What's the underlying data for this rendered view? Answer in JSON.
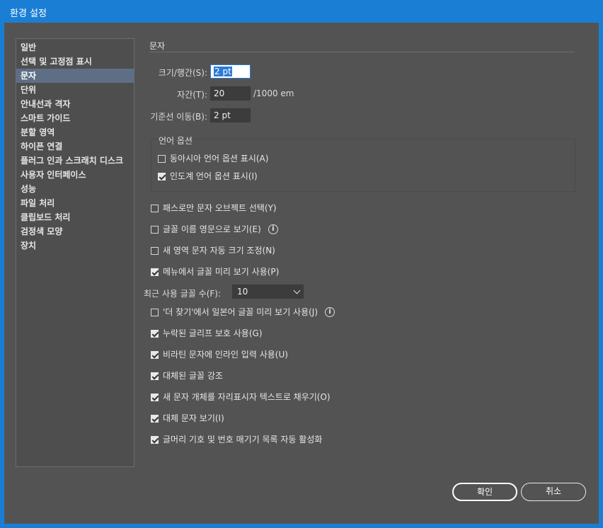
{
  "window": {
    "title": "환경 설정"
  },
  "sidebar": {
    "items": [
      {
        "label": "일반"
      },
      {
        "label": "선택 및 고정점 표시"
      },
      {
        "label": "문자"
      },
      {
        "label": "단위"
      },
      {
        "label": "안내선과 격자"
      },
      {
        "label": "스마트 가이드"
      },
      {
        "label": "분할 영역"
      },
      {
        "label": "하이픈 연결"
      },
      {
        "label": "플러그 인과 스크래치 디스크"
      },
      {
        "label": "사용자 인터페이스"
      },
      {
        "label": "성능"
      },
      {
        "label": "파일 처리"
      },
      {
        "label": "클립보드 처리"
      },
      {
        "label": "검정색 모양"
      },
      {
        "label": "장치"
      }
    ],
    "active_index": 2
  },
  "panel": {
    "section_title": "문자",
    "size_leading": {
      "label": "크기/행간(S):",
      "value": "2 pt"
    },
    "tracking": {
      "label": "자간(T):",
      "value": "20",
      "unit": "/1000 em"
    },
    "baseline_shift": {
      "label": "기준선 이동(B):",
      "value": "2 pt"
    },
    "language_options": {
      "title": "언어 옵션",
      "east_asian": {
        "label": "동아시아 언어 옵션 표시(A)",
        "checked": false
      },
      "indic": {
        "label": "인도계 언어 옵션 표시(I)",
        "checked": true
      }
    },
    "checkboxes": [
      {
        "label": "패스로만 문자 오브젝트 선택(Y)",
        "checked": false
      },
      {
        "label": "글꼴 이름 영문으로 보기(E)",
        "checked": false,
        "info": true
      },
      {
        "label": "새 영역 문자 자동 크기 조정(N)",
        "checked": false
      },
      {
        "label": "메뉴에서 글꼴 미리 보기 사용(P)",
        "checked": true
      }
    ],
    "recent_fonts": {
      "label": "최근 사용 글꼴 수(F):",
      "value": "10"
    },
    "checkboxes2": [
      {
        "label": "'더 찾기'에서 일본어 글꼴 미리 보기 사용(J)",
        "checked": false,
        "info": true
      },
      {
        "label": "누락된 글리프 보호 사용(G)",
        "checked": true
      },
      {
        "label": "비라틴 문자에 인라인 입력 사용(U)",
        "checked": true
      },
      {
        "label": "대체된 글꼴 강조",
        "checked": true
      },
      {
        "label": "새 문자 개체를 자리표시자 텍스트로 채우기(O)",
        "checked": true
      },
      {
        "label": "대체 문자 보기(I)",
        "checked": true
      },
      {
        "label": "글머리 기호 및 번호 매기기 목록 자동 활성화",
        "checked": true
      }
    ]
  },
  "buttons": {
    "ok": "확인",
    "cancel": "취소"
  },
  "icons": {
    "info": "info-icon",
    "dropdown": "chevron-down-icon",
    "checkbox": "checkbox-icon"
  },
  "colors": {
    "title_bar": "#1a7fd4",
    "background": "#535353",
    "selection": "#5e6f85"
  }
}
